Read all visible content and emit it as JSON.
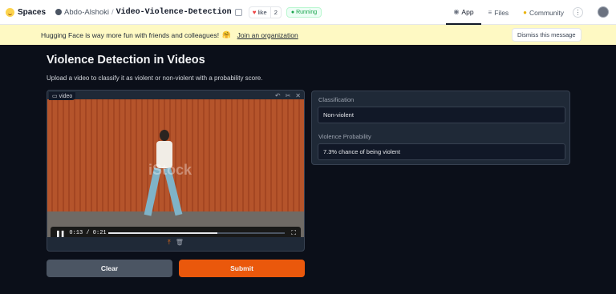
{
  "nav": {
    "brand": "Spaces",
    "owner": "Abdo-Alshoki",
    "separator": "/",
    "space_name": "Video-Violence-Detection",
    "like_label": "like",
    "like_count": "2",
    "status": "Running",
    "tabs": [
      {
        "icon": "app-icon",
        "label": "App"
      },
      {
        "icon": "files-icon",
        "label": "Files"
      },
      {
        "icon": "community-icon",
        "label": "Community"
      }
    ]
  },
  "banner": {
    "message": "Hugging Face is way more fun with friends and colleagues!",
    "emoji": "🤗",
    "link": "Join an organization",
    "dismiss": "Dismiss this message"
  },
  "app": {
    "title": "Violence Detection in Videos",
    "description": "Upload a video to classify it as violent or non-violent with a probability score.",
    "video": {
      "label": "video",
      "time": "0:13 / 0:21",
      "progress": 0.62,
      "watermark": "iStock"
    },
    "buttons": {
      "clear": "Clear",
      "submit": "Submit"
    },
    "outputs": {
      "classification_label": "Classification",
      "classification_value": "Non-violent",
      "probability_label": "Violence Probability",
      "probability_value": "7.3% chance of being violent"
    }
  },
  "colors": {
    "accent": "#ea580c",
    "background": "#0b0f19",
    "panel": "#1f2937",
    "banner": "#fef9c3"
  }
}
